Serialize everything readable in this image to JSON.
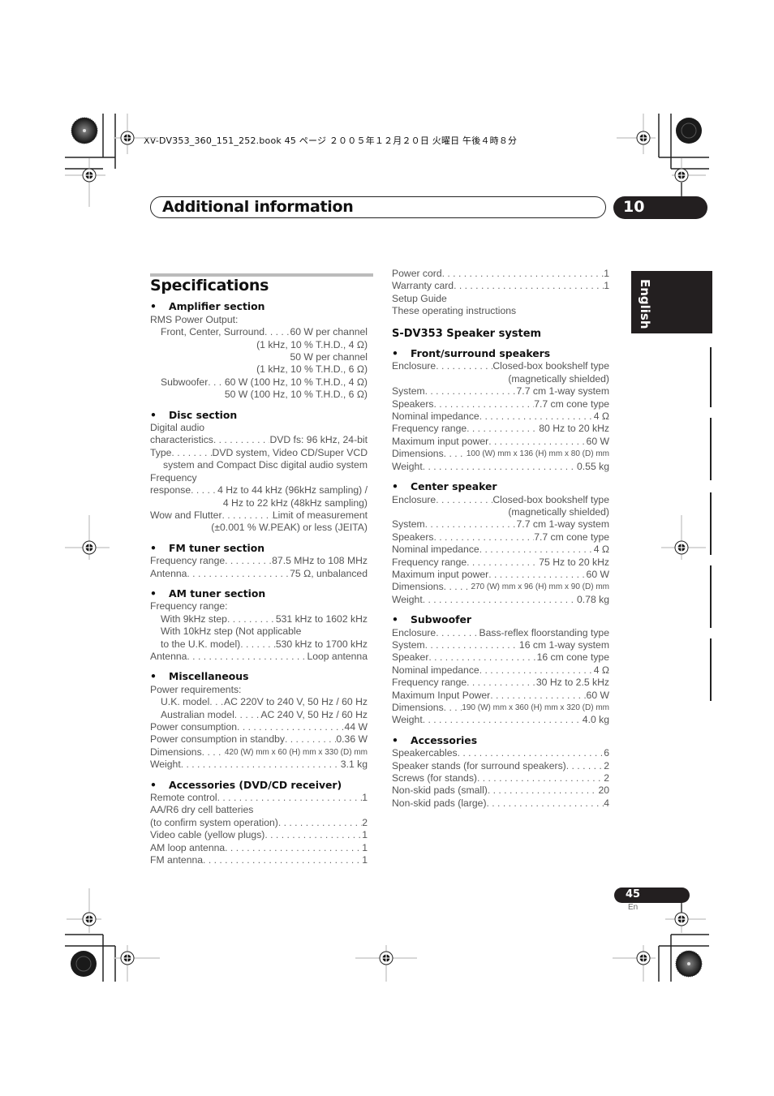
{
  "print_slug": "XV-DV353_360_151_252.book  45 ページ  ２００５年１２月２０日  火曜日  午後４時８分",
  "header": {
    "title": "Additional information",
    "chapter_number": "10"
  },
  "language_tab": "English",
  "page": {
    "number": "45",
    "lang": "En"
  },
  "specifications": {
    "title": "Specifications",
    "left_sections": [
      {
        "heading": "Amplifier section",
        "lines": [
          {
            "type": "plain",
            "text": "RMS Power Output:"
          },
          {
            "type": "pair",
            "indent": true,
            "label": "Front, Center, Surround ",
            "value": " 60 W per channel"
          },
          {
            "type": "right",
            "text": "(1 kHz, 10 % T.H.D., 4 Ω)"
          },
          {
            "type": "right",
            "text": "50 W per channel"
          },
          {
            "type": "right",
            "text": "(1 kHz, 10 % T.H.D., 6 Ω)"
          },
          {
            "type": "pair",
            "indent": true,
            "label": "Subwoofer ",
            "value": " 60 W (100 Hz, 10 % T.H.D., 4 Ω)"
          },
          {
            "type": "right",
            "text": "50 W (100 Hz, 10 % T.H.D., 6 Ω)"
          }
        ]
      },
      {
        "heading": "Disc section",
        "lines": [
          {
            "type": "plain",
            "text": "Digital audio"
          },
          {
            "type": "pair",
            "label": "characteristics ",
            "value": "DVD fs: 96 kHz, 24-bit"
          },
          {
            "type": "pair",
            "label": "Type",
            "value": "DVD system, Video CD/Super VCD"
          },
          {
            "type": "right",
            "text": "system and Compact Disc digital audio system"
          },
          {
            "type": "plain",
            "text": "Frequency"
          },
          {
            "type": "pair",
            "label": "response",
            "value": " 4 Hz to 44 kHz (96kHz sampling) /"
          },
          {
            "type": "right",
            "text": "4 Hz to 22 kHz (48kHz sampling)"
          },
          {
            "type": "pair",
            "label": "Wow and Flutter",
            "value": " Limit of measurement"
          },
          {
            "type": "right",
            "text": "(±0.001 % W.PEAK) or less (JEITA)"
          }
        ]
      },
      {
        "heading": "FM tuner section",
        "lines": [
          {
            "type": "pair",
            "label": "Frequency range ",
            "value": "87.5 MHz to 108 MHz"
          },
          {
            "type": "pair",
            "label": "Antenna ",
            "value": "75 Ω, unbalanced"
          }
        ]
      },
      {
        "heading": "AM tuner section",
        "lines": [
          {
            "type": "plain",
            "text": "Frequency range:"
          },
          {
            "type": "pair",
            "indent": true,
            "label": "With 9kHz step",
            "value": "531 kHz to 1602 kHz"
          },
          {
            "type": "plain",
            "indent": true,
            "text": "With 10kHz step (Not applicable"
          },
          {
            "type": "pair",
            "indent": true,
            "label": "to the U.K. model) ",
            "value": "530 kHz to 1700 kHz"
          },
          {
            "type": "pair",
            "label": "Antenna ",
            "value": " Loop antenna"
          }
        ]
      },
      {
        "heading": "Miscellaneous",
        "lines": [
          {
            "type": "plain",
            "text": "Power requirements:"
          },
          {
            "type": "pair",
            "indent": true,
            "label": "U.K. model ",
            "value": " AC 220V to 240 V, 50 Hz / 60 Hz"
          },
          {
            "type": "pair",
            "indent": true,
            "label": "Australian model",
            "value": " AC 240 V, 50 Hz / 60 Hz"
          },
          {
            "type": "pair",
            "label": "Power consumption ",
            "value": "44 W"
          },
          {
            "type": "pair",
            "label": "Power consumption in standby ",
            "value": " 0.36 W"
          },
          {
            "type": "pair",
            "label": "Dimensions ",
            "value": "420 (W) mm x 60 (H) mm x 330 (D) mm",
            "small": true
          },
          {
            "type": "pair",
            "label": "Weight ",
            "value": "3.1 kg"
          }
        ]
      },
      {
        "heading": "Accessories (DVD/CD receiver)",
        "lines": [
          {
            "type": "pair",
            "label": "Remote control ",
            "value": "1"
          },
          {
            "type": "plain",
            "text": "AA/R6 dry cell batteries"
          },
          {
            "type": "pair",
            "label": "(to confirm system operation) ",
            "value": "2"
          },
          {
            "type": "pair",
            "label": "Video cable (yellow plugs) ",
            "value": "1"
          },
          {
            "type": "pair",
            "label": "AM loop antenna",
            "value": "1"
          },
          {
            "type": "pair",
            "label": "FM antenna ",
            "value": "1"
          }
        ]
      }
    ],
    "right_top_lines": [
      {
        "type": "pair",
        "label": "Power cord ",
        "value": " 1"
      },
      {
        "type": "pair",
        "label": "Warranty card",
        "value": " 1"
      },
      {
        "type": "plain",
        "text": "Setup Guide"
      },
      {
        "type": "plain",
        "text": "These operating instructions"
      }
    ],
    "speaker_system_title": "S-DV353 Speaker system",
    "right_sections": [
      {
        "heading": "Front/surround speakers",
        "lines": [
          {
            "type": "pair",
            "label": "Enclosure ",
            "value": " Closed-box bookshelf type"
          },
          {
            "type": "right",
            "text": "(magnetically shielded)"
          },
          {
            "type": "pair",
            "label": "System",
            "value": "7.7 cm 1-way system"
          },
          {
            "type": "pair",
            "label": "Speakers ",
            "value": " 7.7 cm cone type"
          },
          {
            "type": "pair",
            "label": "Nominal impedance",
            "value": " 4 Ω"
          },
          {
            "type": "pair",
            "label": "Frequency range ",
            "value": " 80 Hz to 20 kHz"
          },
          {
            "type": "pair",
            "label": "Maximum input power",
            "value": " 60 W"
          },
          {
            "type": "pair",
            "label": "Dimensions ",
            "value": " 100 (W) mm x 136 (H) mm x 80 (D) mm",
            "small": true
          },
          {
            "type": "pair",
            "label": "Weight",
            "value": " 0.55 kg"
          }
        ]
      },
      {
        "heading": "Center speaker",
        "lines": [
          {
            "type": "pair",
            "label": "Enclosure ",
            "value": " Closed-box bookshelf type"
          },
          {
            "type": "right",
            "text": "(magnetically shielded)"
          },
          {
            "type": "pair",
            "label": "System",
            "value": "7.7 cm 1-way system"
          },
          {
            "type": "pair",
            "label": "Speakers ",
            "value": " 7.7 cm cone type"
          },
          {
            "type": "pair",
            "label": "Nominal impedance",
            "value": " 4 Ω"
          },
          {
            "type": "pair",
            "label": "Frequency range ",
            "value": " 75 Hz to 20 kHz"
          },
          {
            "type": "pair",
            "label": "Maximum input power",
            "value": " 60 W"
          },
          {
            "type": "pair",
            "label": "Dimensions ",
            "value": " 270 (W) mm x 96 (H) mm x 90 (D) mm",
            "small": true
          },
          {
            "type": "pair",
            "label": "Weight",
            "value": " 0.78 kg"
          }
        ]
      },
      {
        "heading": "Subwoofer",
        "lines": [
          {
            "type": "pair",
            "label": "Enclosure ",
            "value": " Bass-reflex floorstanding type"
          },
          {
            "type": "pair",
            "label": "System",
            "value": " 16 cm 1-way system"
          },
          {
            "type": "pair",
            "label": "Speaker ",
            "value": "16 cm cone type"
          },
          {
            "type": "pair",
            "label": "Nominal impedance",
            "value": " 4 Ω"
          },
          {
            "type": "pair",
            "label": "Frequency range ",
            "value": "30 Hz to 2.5 kHz"
          },
          {
            "type": "pair",
            "label": "Maximum Input Power",
            "value": " 60 W"
          },
          {
            "type": "pair",
            "label": "Dimensions ",
            "value": " 190 (W) mm x 360 (H) mm x 320 (D) mm",
            "small": true
          },
          {
            "type": "pair",
            "label": "Weight",
            "value": " 4.0 kg"
          }
        ]
      },
      {
        "heading": "Accessories",
        "lines": [
          {
            "type": "pair",
            "label": "Speakercables ",
            "value": " 6"
          },
          {
            "type": "pair",
            "label": "Speaker stands (for surround speakers) ",
            "value": " 2"
          },
          {
            "type": "pair",
            "label": "Screws (for stands)",
            "value": " 2"
          },
          {
            "type": "pair",
            "label": "Non-skid pads (small) ",
            "value": " 20"
          },
          {
            "type": "pair",
            "label": "Non-skid pads (large)",
            "value": " 4"
          }
        ]
      }
    ]
  },
  "icons": {
    "bullet": "•"
  }
}
